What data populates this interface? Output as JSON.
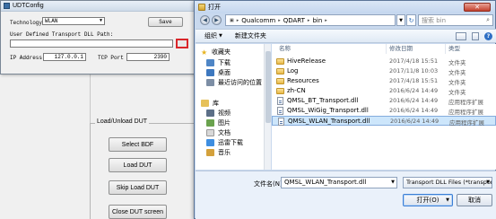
{
  "udt": {
    "title": "UDTConfig",
    "technology_label": "Technology",
    "technology_value": "WLAN",
    "save_label": "Save",
    "path_label": "User Defined Transport DLL Path:",
    "path_value": "",
    "ip_label": "IP Address",
    "ip_value": "127.0.0.1",
    "tcp_label": "TCP Port",
    "tcp_value": "2390"
  },
  "background": {
    "group_title": "Load/Unload DUT",
    "buttons": [
      "Select BDF",
      "Load DUT",
      "Skip Load DUT",
      "Close DUT screen"
    ]
  },
  "dialog": {
    "title": "打开",
    "breadcrumb": [
      "Qualcomm",
      "QDART",
      "bin"
    ],
    "search_placeholder": "搜索 bin",
    "toolbar": {
      "organize": "组织",
      "new_folder": "新建文件夹"
    },
    "nav": {
      "favorites": "收藏夹",
      "downloads": "下载",
      "desktop": "桌面",
      "recent": "最近访问的位置",
      "libraries": "库",
      "videos": "视频",
      "pictures": "图片",
      "documents": "文档",
      "xunlei": "迅雷下载",
      "music": "音乐"
    },
    "columns": {
      "name": "名称",
      "date": "修改日期",
      "type": "类型"
    },
    "files": [
      {
        "name": "HiveRelease",
        "date": "2017/4/18 15:51",
        "type": "文件夹",
        "kind": "folder"
      },
      {
        "name": "Log",
        "date": "2017/11/8 10:03",
        "type": "文件夹",
        "kind": "folder"
      },
      {
        "name": "Resources",
        "date": "2017/4/18 15:51",
        "type": "文件夹",
        "kind": "folder"
      },
      {
        "name": "zh-CN",
        "date": "2016/6/24 14:49",
        "type": "文件夹",
        "kind": "folder"
      },
      {
        "name": "QMSL_BT_Transport.dll",
        "date": "2016/6/24 14:49",
        "type": "应用程序扩展",
        "kind": "file"
      },
      {
        "name": "QMSL_WiGig_Transport.dll",
        "date": "2016/6/24 14:49",
        "type": "应用程序扩展",
        "kind": "file"
      },
      {
        "name": "QMSL_WLAN_Transport.dll",
        "date": "2016/6/24 14:49",
        "type": "应用程序扩展",
        "kind": "file"
      }
    ],
    "filename_label": "文件名(N):",
    "filename_value": "QMSL_WLAN_Transport.dll",
    "filetype_value": "Transport DLL Files (*transpor",
    "open_label": "打开(O)",
    "cancel_label": "取消"
  }
}
